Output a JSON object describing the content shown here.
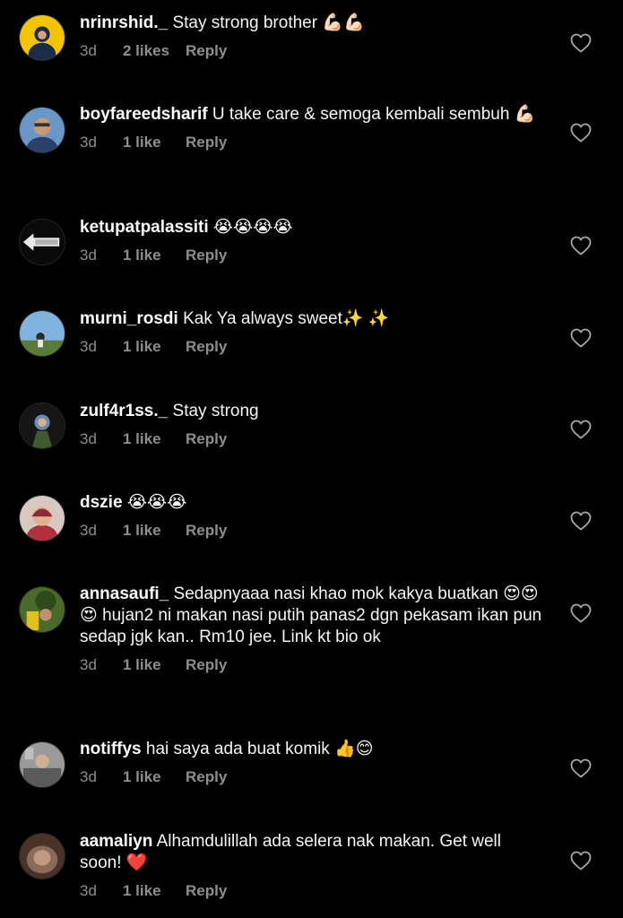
{
  "comments": [
    {
      "username": "nrinrshid._",
      "text": "Stay strong brother 💪🏻💪🏻",
      "time": "3d",
      "likes": "2 likes",
      "reply": "Reply",
      "avatar_color": "#f5c400"
    },
    {
      "username": "boyfareedsharif",
      "text": "U take care & semoga kembali sembuh 💪🏻",
      "time": "3d",
      "likes": "1 like",
      "reply": "Reply",
      "avatar_color": "#5b87b8"
    },
    {
      "username": "ketupatpalassiti",
      "text": "😭😭😭😭",
      "time": "3d",
      "likes": "1 like",
      "reply": "Reply",
      "avatar_color": "#e8e8e8"
    },
    {
      "username": "murni_rosdi",
      "text": "Kak Ya always sweet✨ ✨",
      "time": "3d",
      "likes": "1 like",
      "reply": "Reply",
      "avatar_color": "#6fa7d6"
    },
    {
      "username": "zulf4r1ss._",
      "text": "Stay strong",
      "time": "3d",
      "likes": "1 like",
      "reply": "Reply",
      "avatar_color": "#1a1a1a"
    },
    {
      "username": "dszie",
      "text": "😭😭😭",
      "time": "3d",
      "likes": "1 like",
      "reply": "Reply",
      "avatar_color": "#c9b6b0"
    },
    {
      "username": "annasaufi_",
      "text": "Sedapnyaaa nasi khao mok kakya buatkan 😍😍😍 hujan2 ni makan nasi putih panas2 dgn pekasam ikan pun sedap jgk kan.. Rm10 jee. Link kt bio ok",
      "time": "3d",
      "likes": "1 like",
      "reply": "Reply",
      "avatar_color": "#3f5a2a"
    },
    {
      "username": "notiffys",
      "text": "hai saya ada buat komik 👍😊",
      "time": "3d",
      "likes": "1 like",
      "reply": "Reply",
      "avatar_color": "#8c8c8c"
    },
    {
      "username": "aamaliyn",
      "text": "Alhamdulillah ada selera nak makan. Get well soon! ❤️",
      "time": "3d",
      "likes": "1 like",
      "reply": "Reply",
      "avatar_color": "#6a4a3a"
    }
  ]
}
